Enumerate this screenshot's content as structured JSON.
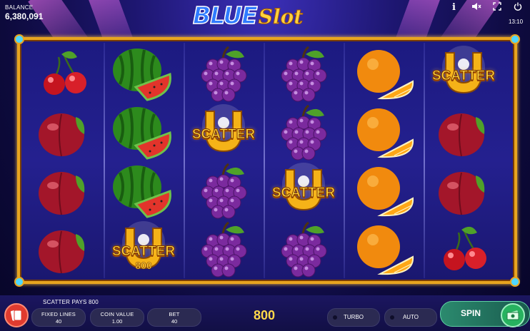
{
  "header": {
    "balance_label": "BALANCE",
    "balance_value": "6,380,091",
    "logo_blue": "BLUE",
    "logo_slot": "Slot",
    "clock": "13:10",
    "icons": [
      "info-icon",
      "sound-off-icon",
      "fullscreen-icon",
      "power-icon"
    ]
  },
  "reels": [
    [
      "cherry",
      "plum",
      "plum",
      "plum"
    ],
    [
      "watermelon",
      "watermelon",
      "watermelon",
      "scatter"
    ],
    [
      "grapes",
      "scatter",
      "grapes",
      "grapes"
    ],
    [
      "grapes",
      "grapes",
      "scatter",
      "grapes"
    ],
    [
      "orange",
      "orange",
      "orange",
      "orange"
    ],
    [
      "scatter",
      "plum",
      "plum",
      "cherry"
    ]
  ],
  "symbols": {
    "scatter_label": "SCATTER",
    "scatter_win_amount": "800"
  },
  "bottom": {
    "message": "SCATTER PAYS 800",
    "fixed_lines_label": "FIXED LINES",
    "fixed_lines_value": "40",
    "coin_value_label": "COIN VALUE",
    "coin_value_value": "1.00",
    "bet_label": "BET",
    "bet_value": "40",
    "win_value": "800",
    "turbo_label": "TURBO",
    "auto_label": "AUTO",
    "spin_label": "SPIN"
  },
  "colors": {
    "frame": "#e8a51f",
    "scatter_text": "#ffd83d",
    "spin_button": "#2b8a6e",
    "menu_button": "#e03b2f"
  }
}
